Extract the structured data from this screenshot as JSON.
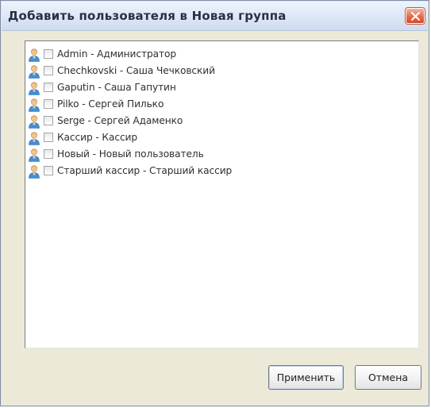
{
  "dialog": {
    "title": "Добавить пользователя в Новая группа"
  },
  "user_list": {
    "items": [
      {
        "label": "Admin - Администратор",
        "checked": false,
        "icon": "user-icon"
      },
      {
        "label": "Chechkovski - Саша Чечковский",
        "checked": false,
        "icon": "user-icon"
      },
      {
        "label": "Gaputin - Саша Гапутин",
        "checked": false,
        "icon": "user-icon"
      },
      {
        "label": "Pilko - Сергей Пилько",
        "checked": false,
        "icon": "user-icon"
      },
      {
        "label": "Serge - Сергей Адаменко",
        "checked": false,
        "icon": "user-icon"
      },
      {
        "label": "Кассир - Кассир",
        "checked": false,
        "icon": "user-icon"
      },
      {
        "label": "Новый - Новый пользователь",
        "checked": false,
        "icon": "user-icon"
      },
      {
        "label": "Старший кассир - Старший кассир",
        "checked": false,
        "icon": "user-icon"
      }
    ]
  },
  "buttons": {
    "apply_label": "Применить",
    "cancel_label": "Отмена"
  },
  "colors": {
    "close_button": "#e96a4a",
    "title_bar": "#dfe9f8",
    "window_body": "#ece9d8"
  }
}
